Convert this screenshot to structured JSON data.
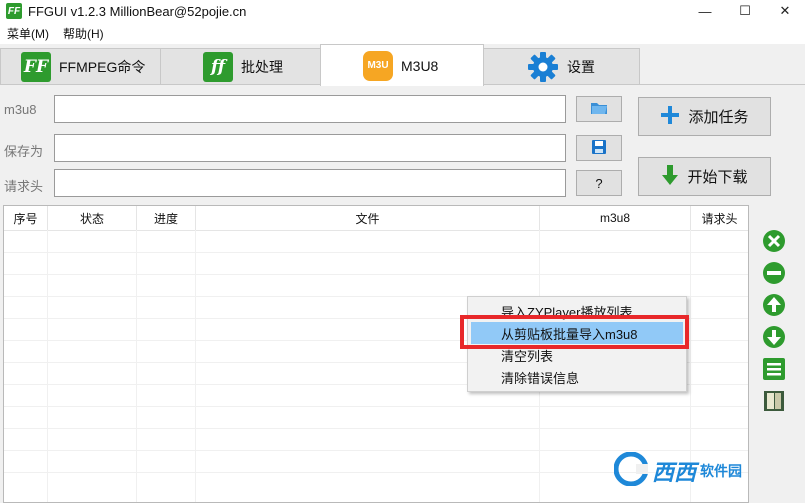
{
  "window": {
    "title": "FFGUI v1.2.3    MillionBear@52pojie.cn",
    "minimize": "—",
    "maximize": "☐",
    "close": "✕"
  },
  "app_icon": "FF",
  "menu": [
    {
      "label": "菜单(M)"
    },
    {
      "label": "帮助(H)"
    }
  ],
  "tabs": [
    {
      "label": "FFMPEG命令",
      "icon": "FF"
    },
    {
      "label": "批处理",
      "icon": "ff"
    },
    {
      "label": "M3U8",
      "icon": "M3U"
    },
    {
      "label": "设置",
      "icon": "gear-icon"
    }
  ],
  "form": {
    "m3u8_label": "m3u8",
    "m3u8_value": "",
    "save_label": "保存为",
    "save_value": "",
    "header_label": "请求头",
    "header_value": "",
    "help_btn": "?"
  },
  "buttons": {
    "add_task": "添加任务",
    "start_download": "开始下载"
  },
  "table": {
    "columns": [
      "序号",
      "状态",
      "进度",
      "文件",
      "m3u8",
      "请求头"
    ],
    "rows": []
  },
  "context_menu": {
    "items": [
      {
        "label": "导入ZYPlayer播放列表"
      },
      {
        "label": "从剪贴板批量导入m3u8"
      },
      {
        "label": "清空列表"
      },
      {
        "label": "清除错误信息"
      }
    ],
    "highlighted_index": 1
  },
  "watermark": {
    "text": "西西",
    "sub": "软件园"
  },
  "colors": {
    "accent": "#2e9b2e",
    "m3u_orange": "#f6a623",
    "highlight": "#91c9f7",
    "red_box": "#e8282a"
  }
}
